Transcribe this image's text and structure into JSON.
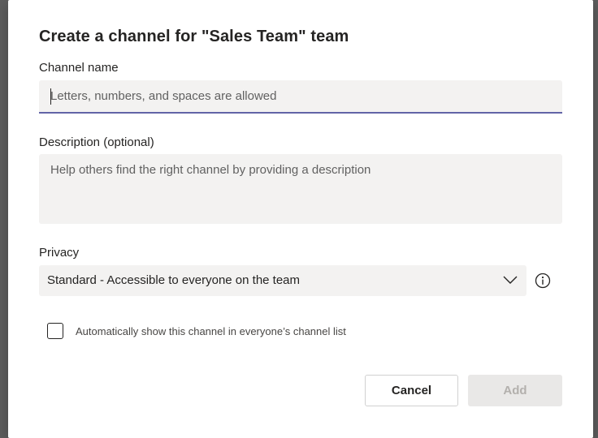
{
  "dialog": {
    "title": "Create a channel for \"Sales Team\" team",
    "channel_name": {
      "label": "Channel name",
      "value": "",
      "placeholder": "Letters, numbers, and spaces are allowed"
    },
    "description": {
      "label": "Description (optional)",
      "value": "",
      "placeholder": "Help others find the right channel by providing a description"
    },
    "privacy": {
      "label": "Privacy",
      "selected": "Standard - Accessible to everyone on the team",
      "chevron_icon": "chevron-down-icon",
      "info_icon": "info-icon"
    },
    "auto_show": {
      "label": "Automatically show this channel in everyone’s channel list",
      "checked": false
    },
    "buttons": {
      "cancel": "Cancel",
      "add": "Add",
      "add_enabled": false
    },
    "colors": {
      "accent": "#6264a7",
      "field_bg": "#f3f2f1",
      "text": "#252423",
      "disabled_bg": "#e9e8e7",
      "disabled_text": "#b3b0ad"
    }
  }
}
